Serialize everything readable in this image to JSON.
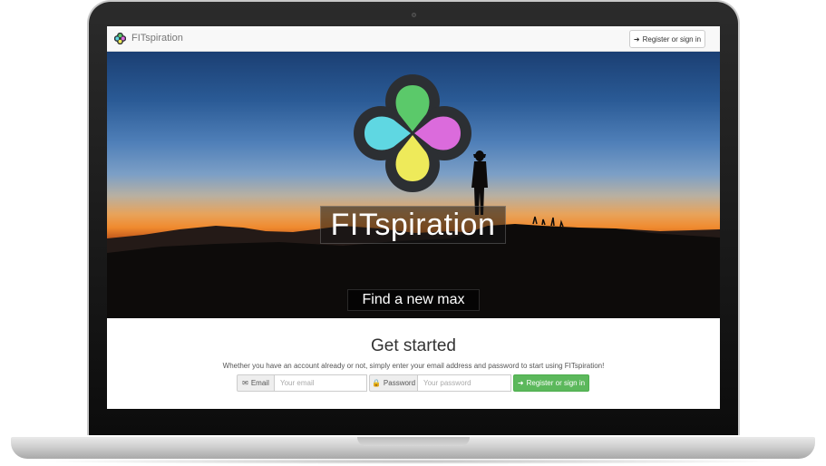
{
  "navbar": {
    "brand": "FITspiration",
    "register_button": "Register or sign in",
    "register_icon": "sign-in-icon"
  },
  "hero": {
    "title": "FITspiration",
    "subtitle": "Find a new max",
    "logo_colors": {
      "top": "#5bc96a",
      "right": "#db6bdc",
      "bottom": "#eeea5a",
      "left": "#5fd7e2",
      "outline": "#2c2f33"
    }
  },
  "get_started": {
    "heading": "Get started",
    "lead": "Whether you have an account already or not, simply enter your email address and password to start using FITspiration!",
    "email_label": "Email",
    "email_icon": "envelope-icon",
    "email_placeholder": "Your email",
    "password_label": "Password",
    "password_icon": "lock-icon",
    "password_placeholder": "Your password",
    "submit_label": "Register or sign in",
    "submit_color": "#5cb85c"
  }
}
